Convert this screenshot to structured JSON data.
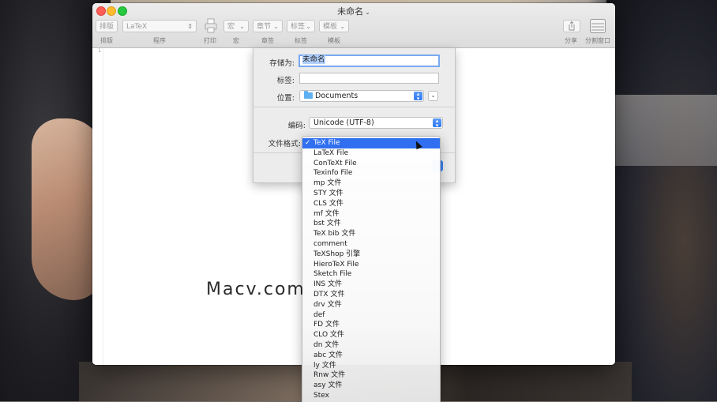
{
  "window": {
    "title": "未命名",
    "title_chevron": "⌄"
  },
  "toolbar": {
    "typeset_button": "排版",
    "engine_select": "LaTeX",
    "macro_select": "宏",
    "chapter_select": "章节",
    "tags_select": "标签",
    "templates_select": "模板",
    "labels": {
      "typeset": "排版",
      "program": "程序",
      "print": "打印",
      "macro": "宏",
      "chapter": "章签",
      "tags": "标签",
      "templates": "模板",
      "share": "分享",
      "split": "分割窗口"
    }
  },
  "editor": {
    "line_number": "1"
  },
  "save_sheet": {
    "save_as_label": "存储为:",
    "save_as_value": "未命名",
    "tags_label": "标签:",
    "tags_value": "",
    "location_label": "位置:",
    "location_value": "Documents",
    "encoding_label": "编码:",
    "encoding_value": "Unicode (UTF-8)",
    "format_label": "文件格式:"
  },
  "format_menu": {
    "selected_index": 0,
    "check_mark": "✓",
    "items": [
      "TeX File",
      "LaTeX File",
      "ConTeXt File",
      "Texinfo File",
      "mp 文件",
      "STY 文件",
      "CLS 文件",
      "mf 文件",
      "bst 文件",
      "TeX bib 文件",
      "comment",
      "TeXShop 引擎",
      "HieroTeX File",
      "Sketch File",
      "INS 文件",
      "DTX 文件",
      "drv 文件",
      "def",
      "FD 文件",
      "CLO 文件",
      "dn 文件",
      "abc 文件",
      "ly 文件",
      "Rnw 文件",
      "asy 文件",
      "Stex"
    ]
  },
  "watermark": {
    "text": "Macv.com"
  },
  "colors": {
    "accent": "#2f6ff0",
    "close": "#ff5f57",
    "minimize": "#febc2e",
    "maximize": "#28c840"
  }
}
